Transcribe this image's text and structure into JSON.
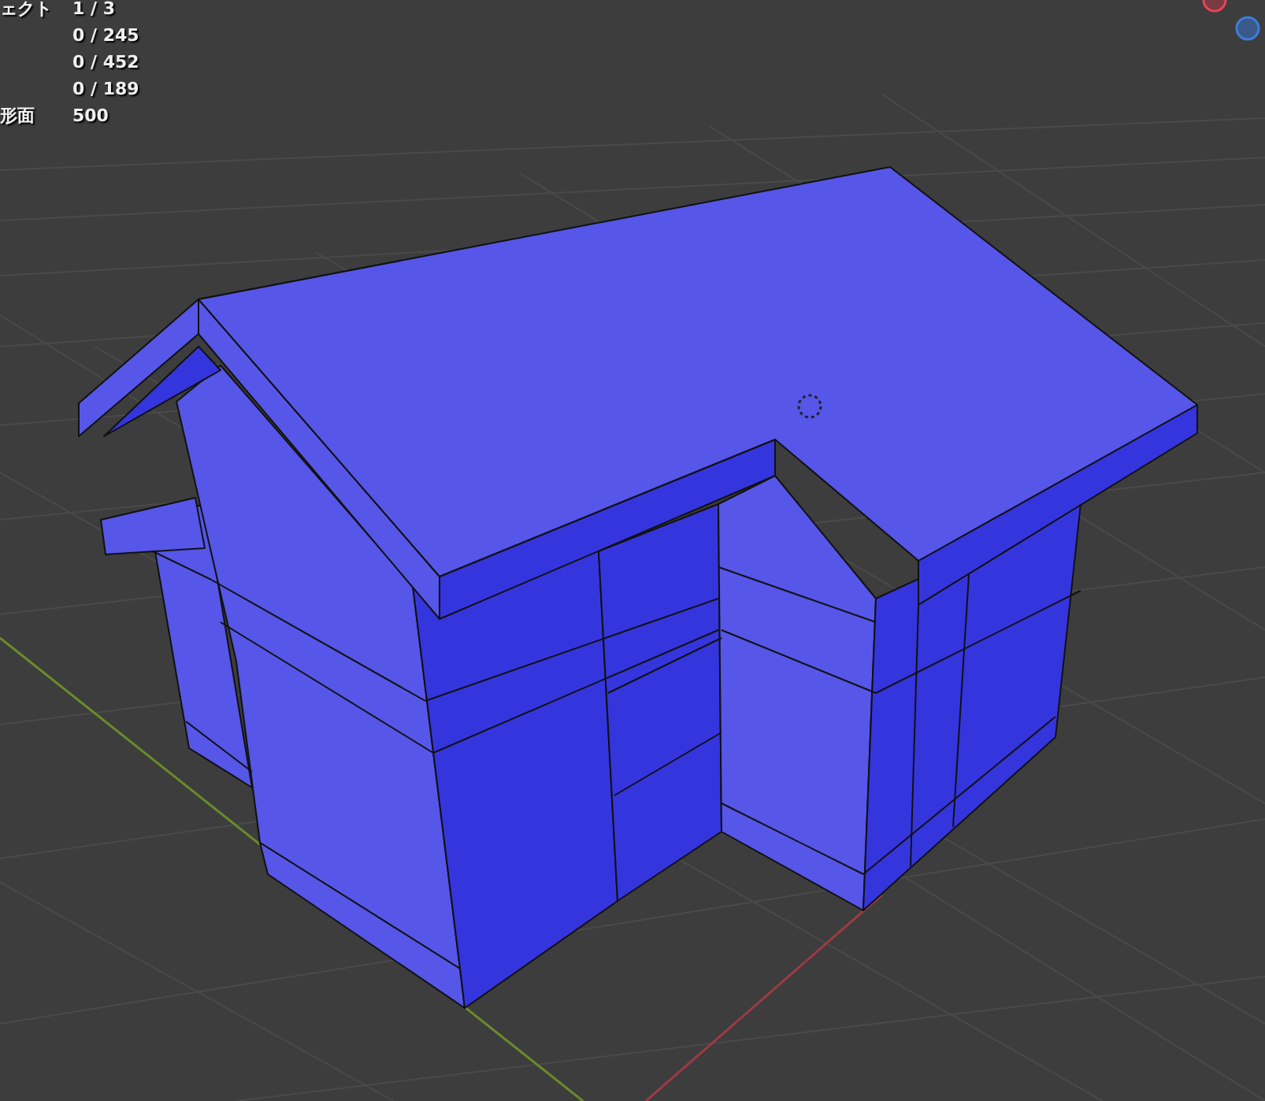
{
  "stats": [
    {
      "label": "ェクト",
      "value": "1 / 3"
    },
    {
      "value": "0 / 245"
    },
    {
      "value": "0 / 452"
    },
    {
      "value": "0 / 189"
    },
    {
      "label": "形面",
      "value": "500"
    }
  ]
}
